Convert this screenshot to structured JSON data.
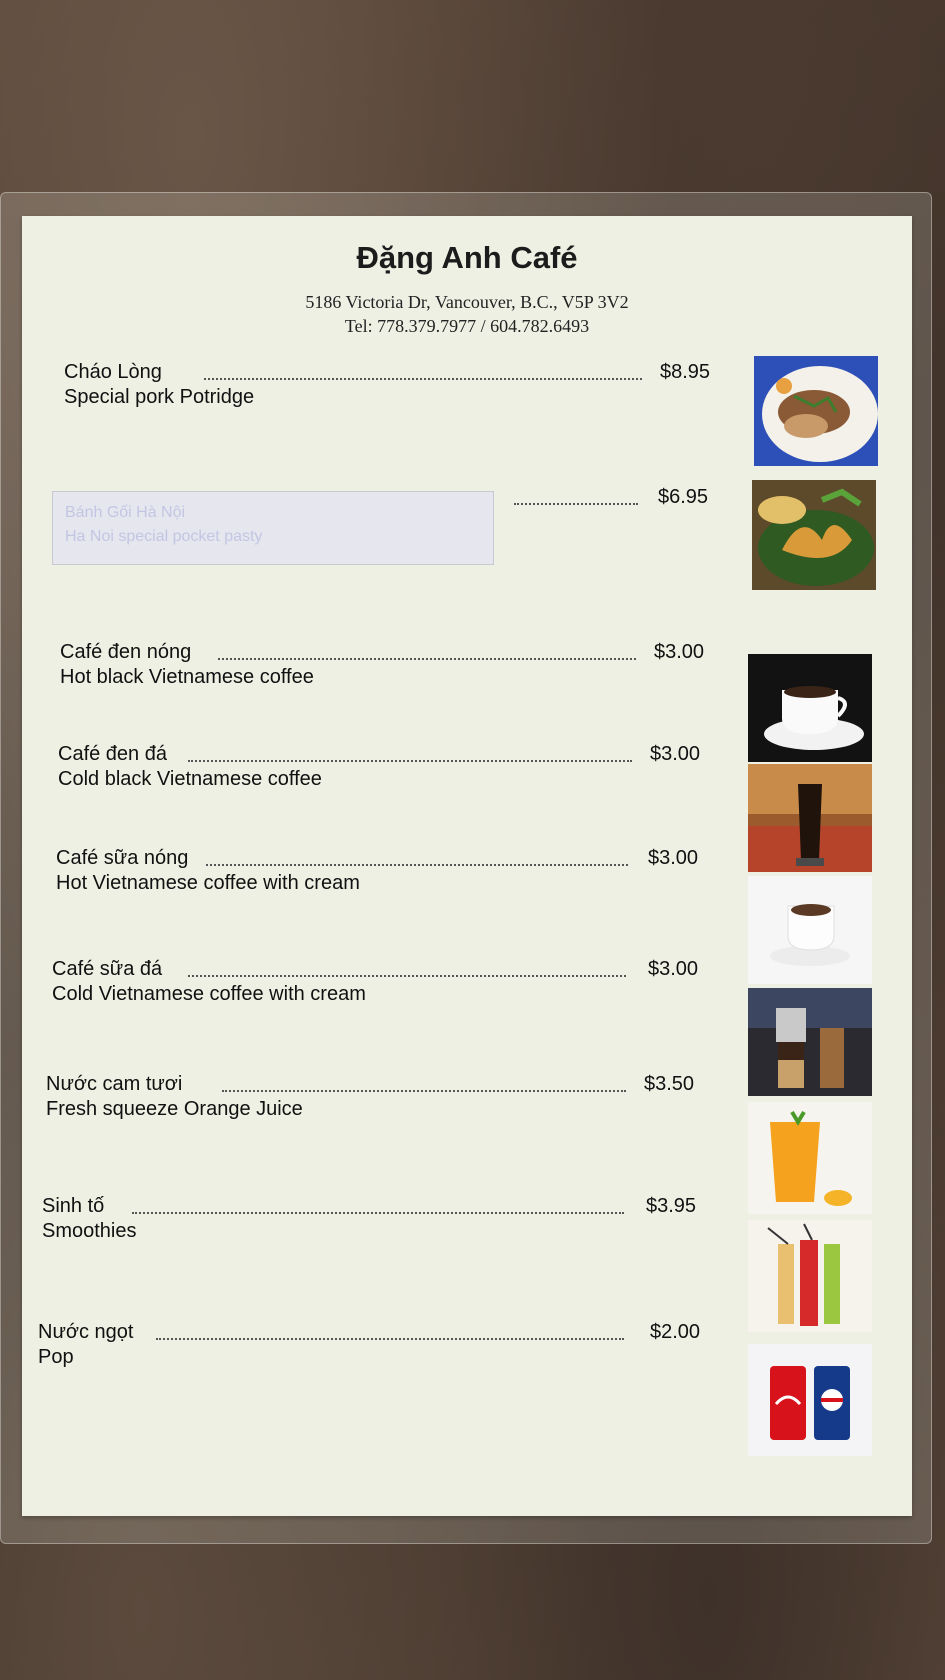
{
  "menu": {
    "title": "Đặng Anh Café",
    "address": "5186 Victoria Dr, Vancouver, B.C., V5P 3V2",
    "tel": "Tel: 778.379.7977 / 604.782.6493",
    "items": [
      {
        "name": "Cháo Lòng",
        "desc": "Special pork Potridge",
        "price": "$8.95",
        "icon": "porridge-photo-icon"
      },
      {
        "name": "",
        "desc": "",
        "price": "$6.95",
        "icon": "pastry-photo-icon"
      },
      {
        "name": "Café đen nóng",
        "desc": "Hot black Vietnamese coffee",
        "price": "$3.00",
        "icon": "hot-coffee-photo-icon"
      },
      {
        "name": "Café đen đá",
        "desc": "Cold black Vietnamese coffee",
        "price": "$3.00",
        "icon": "iced-coffee-photo-icon"
      },
      {
        "name": "Café sữa nóng",
        "desc": "Hot Vietnamese coffee with cream",
        "price": "$3.00",
        "icon": "milk-coffee-photo-icon"
      },
      {
        "name": "Café sữa đá",
        "desc": "Cold Vietnamese coffee with cream",
        "price": "$3.00",
        "icon": "iced-milk-coffee-photo-icon"
      },
      {
        "name": "Nước cam tươi",
        "desc": "Fresh squeeze Orange Juice",
        "price": "$3.50",
        "icon": "orange-juice-photo-icon"
      },
      {
        "name": "Sinh tố",
        "desc": "Smoothies",
        "price": "$3.95",
        "icon": "smoothie-photo-icon"
      },
      {
        "name": "Nước ngọt",
        "desc": "Pop",
        "price": "$2.00",
        "icon": "soda-cans-photo-icon"
      }
    ]
  },
  "redacted_label": {
    "line1": "Bánh Gối Hà Nội",
    "line2": "Ha Noi special pocket pasty"
  },
  "colors": {
    "card": "#eef0e4",
    "text": "#111111",
    "table": "#4e3d31"
  }
}
